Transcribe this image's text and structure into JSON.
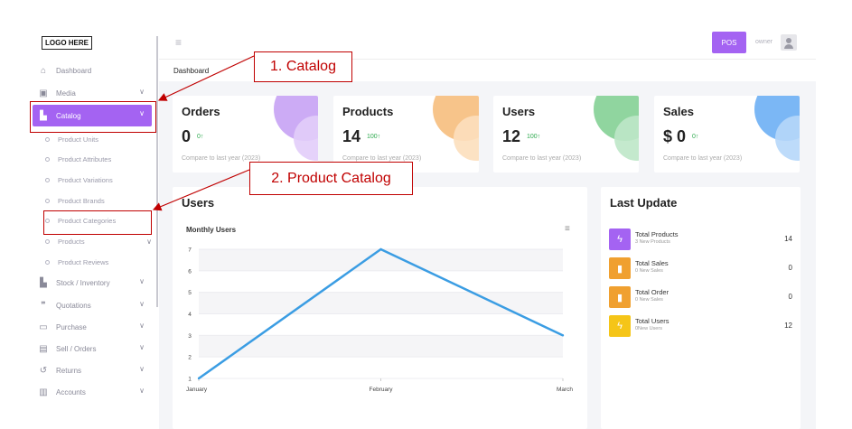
{
  "logo": "LOGO HERE",
  "sidebar": {
    "items": [
      {
        "label": "Dashboard",
        "icon": "home-icon",
        "glyph": "⌂"
      },
      {
        "label": "Media",
        "icon": "image-icon",
        "glyph": "▣",
        "chevron": "∨"
      },
      {
        "label": "Catalog",
        "icon": "catalog-icon",
        "glyph": "▙",
        "chevron": "∨",
        "active": true
      }
    ],
    "catalog_sub": [
      {
        "label": "Product Units"
      },
      {
        "label": "Product Attributes"
      },
      {
        "label": "Product Variations"
      },
      {
        "label": "Product Brands"
      },
      {
        "label": "Product Categories"
      },
      {
        "label": "Products",
        "chevron": "∨"
      },
      {
        "label": "Product Reviews"
      }
    ],
    "bottom_items": [
      {
        "label": "Stock / Inventory",
        "icon": "stock-icon",
        "glyph": "▙",
        "chevron": "∨"
      },
      {
        "label": "Quotations",
        "icon": "quote-icon",
        "glyph": "❞",
        "chevron": "∨"
      },
      {
        "label": "Purchase",
        "icon": "purchase-icon",
        "glyph": "▭",
        "chevron": "∨"
      },
      {
        "label": "Sell / Orders",
        "icon": "clipboard-icon",
        "glyph": "▤",
        "chevron": "∨"
      },
      {
        "label": "Returns",
        "icon": "undo-icon",
        "glyph": "↺",
        "chevron": "∨"
      },
      {
        "label": "Accounts",
        "icon": "document-icon",
        "glyph": "▥",
        "chevron": "∨"
      }
    ]
  },
  "topbar": {
    "menu_glyph": "≡",
    "pos_label": "POS",
    "user_name": "owner"
  },
  "breadcrumb": "Dashboard",
  "stats": [
    {
      "title": "Orders",
      "value": "0",
      "delta": "0↑",
      "compare": "Compare to last year (2023)",
      "color": "#c9a4f5",
      "color2": "#ddc3fa"
    },
    {
      "title": "Products",
      "value": "14",
      "delta": "100↑",
      "compare": "Compare to last year (2023)",
      "color": "#f5c58d",
      "color2": "#fbdcb5"
    },
    {
      "title": "Users",
      "value": "12",
      "delta": "100↑",
      "compare": "Compare to last year (2023)",
      "color": "#8fd49e",
      "color2": "#b8e5c2"
    },
    {
      "title": "Sales",
      "value": "$ 0",
      "delta": "0↑",
      "compare": "Compare to last year (2023)",
      "color": "#7eb8f5",
      "color2": "#b3d5fa"
    }
  ],
  "users_panel": {
    "title": "Users",
    "menu_glyph": "≡"
  },
  "chart_data": {
    "type": "line",
    "title": "Monthly Users",
    "categories": [
      "January",
      "February",
      "March"
    ],
    "values": [
      1,
      7,
      3
    ],
    "ylim": [
      1,
      7
    ],
    "yticks": [
      1,
      2,
      3,
      4,
      5,
      6,
      7
    ],
    "color": "#3b9de3",
    "grid": true,
    "xlabel": "",
    "ylabel": ""
  },
  "last_update": {
    "title": "Last Update",
    "rows": [
      {
        "name": "Total Products",
        "sub": "3 New Products",
        "value": "14",
        "color": "#a463f2",
        "icon": "bolt-icon",
        "glyph": "ϟ"
      },
      {
        "name": "Total Sales",
        "sub": "0 New Sales",
        "value": "0",
        "color": "#f0a030",
        "icon": "bar-chart-icon",
        "glyph": "▮"
      },
      {
        "name": "Total Order",
        "sub": "0 New Sales",
        "value": "0",
        "color": "#f0a030",
        "icon": "bar-chart-icon",
        "glyph": "▮"
      },
      {
        "name": "Total Users",
        "sub": "0New Users",
        "value": "12",
        "color": "#f5c518",
        "icon": "bolt-icon",
        "glyph": "ϟ"
      }
    ]
  },
  "annotations": {
    "first": "1. Catalog",
    "second": "2. Product Catalog",
    "color": "#c00000"
  }
}
